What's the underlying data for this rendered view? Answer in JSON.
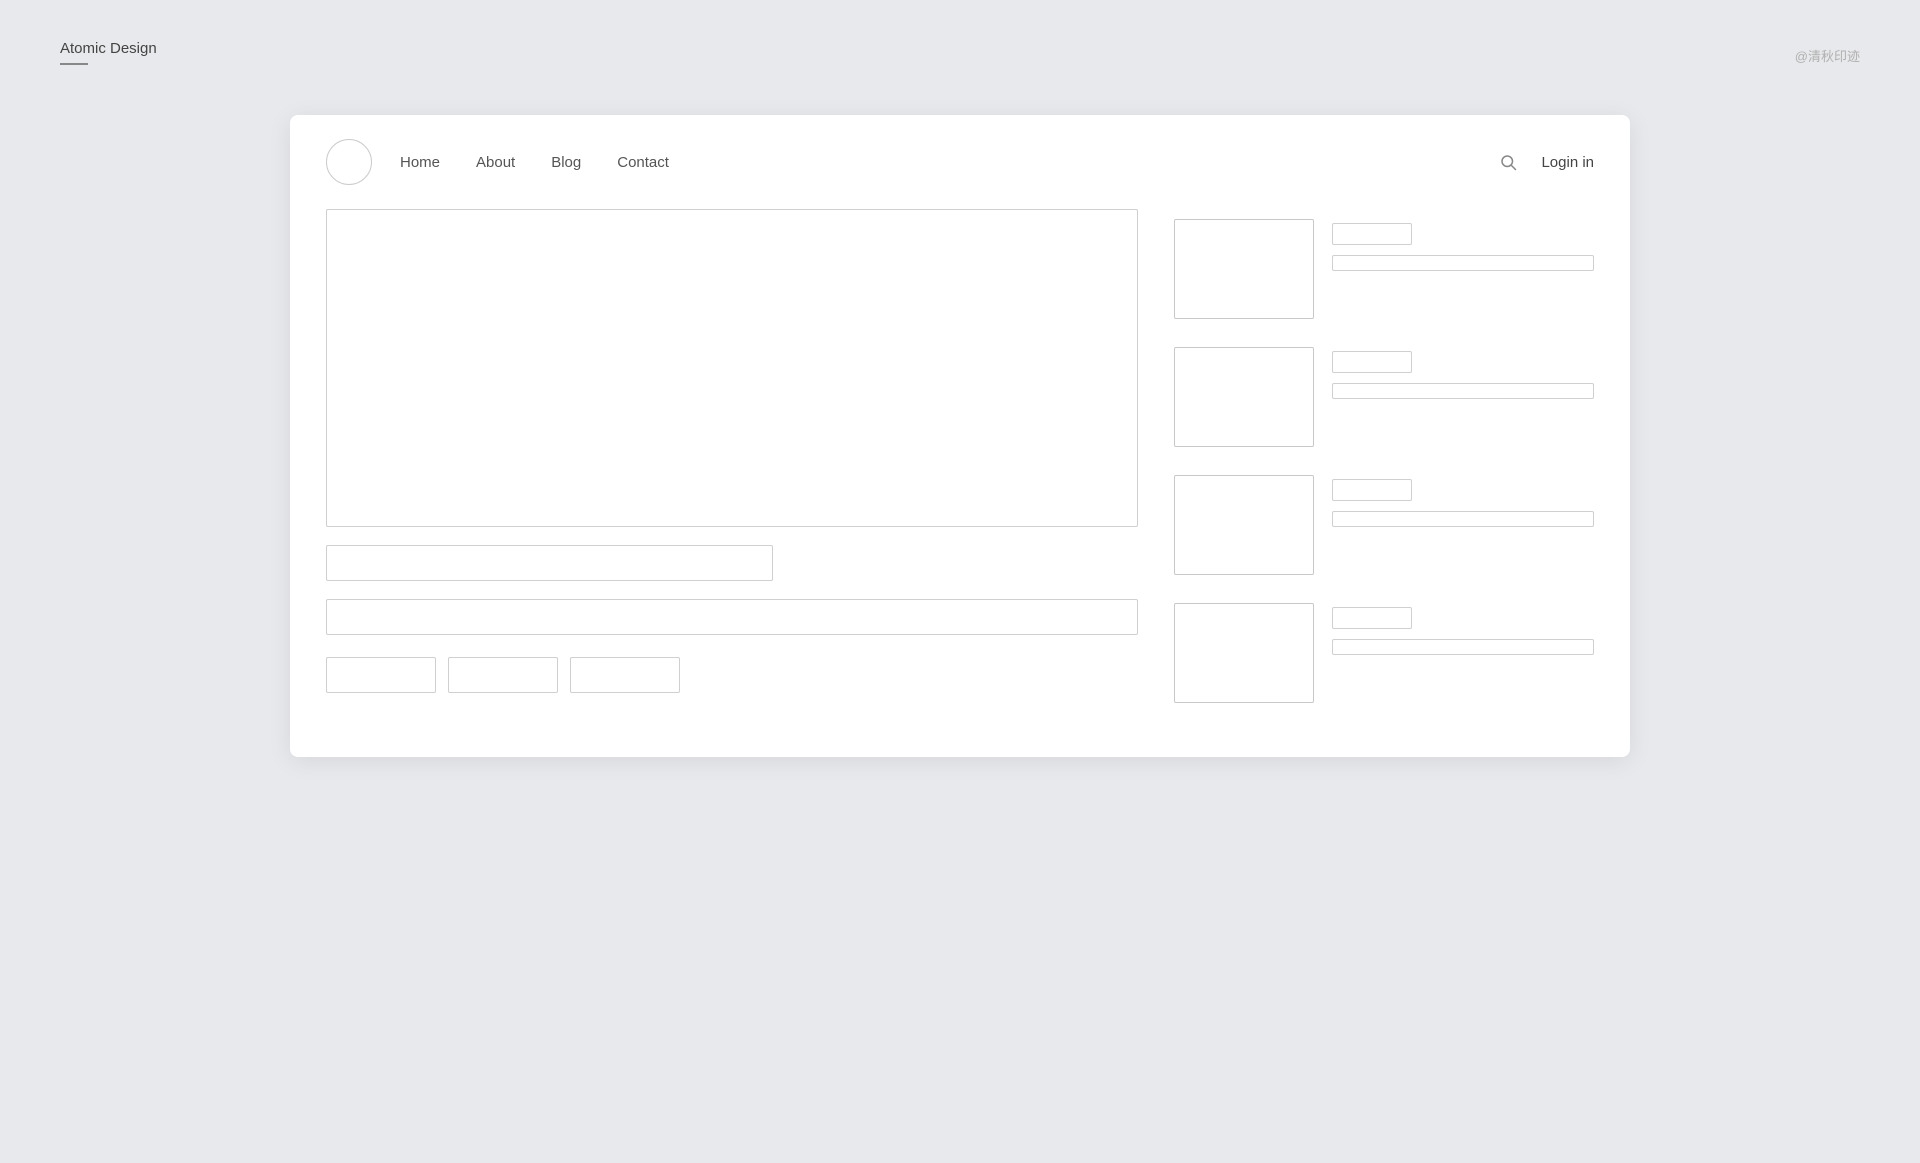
{
  "topBar": {
    "title": "Atomic Design",
    "watermark": "@清秋印迹"
  },
  "navbar": {
    "links": [
      {
        "label": "Home"
      },
      {
        "label": "About"
      },
      {
        "label": "Blog"
      },
      {
        "label": "Contact"
      }
    ],
    "loginLabel": "Login in"
  },
  "leftCol": {
    "buttons": [
      {
        "label": ""
      },
      {
        "label": ""
      },
      {
        "label": ""
      }
    ]
  },
  "rightCol": {
    "items": [
      {
        "id": 1
      },
      {
        "id": 2
      },
      {
        "id": 3
      },
      {
        "id": 4
      }
    ]
  }
}
